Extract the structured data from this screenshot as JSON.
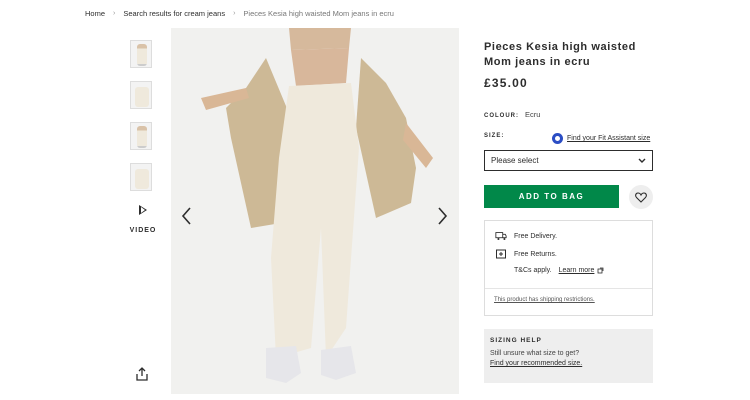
{
  "breadcrumb": {
    "home": "Home",
    "search": "Search results for cream jeans",
    "current": "Pieces Kesia high waisted Mom jeans in ecru",
    "separator": "›"
  },
  "gallery": {
    "video_label": "VIDEO",
    "thumbnail_count": 4
  },
  "product": {
    "title": "Pieces Kesia high waisted Mom jeans in ecru",
    "price": "£35.00",
    "colour_label": "COLOUR:",
    "colour_value": "Ecru",
    "size_label": "SIZE:",
    "fit_assistant_link": "Find your Fit Assistant size",
    "size_select_value": "Please select",
    "add_to_bag": "ADD TO BAG"
  },
  "delivery": {
    "free_delivery": "Free Delivery.",
    "free_returns": "Free Returns.",
    "tcs_prefix": "T&Cs apply.",
    "learn_more": "Learn more",
    "shipping_restrictions": "This product has shipping restrictions."
  },
  "sizing_help": {
    "heading": "SIZING HELP",
    "text": "Still unsure what size to get?",
    "link": "Find your recommended size."
  },
  "colors": {
    "add_to_bag_green": "#018849",
    "fit_icon_blue": "#2b4dc4"
  }
}
